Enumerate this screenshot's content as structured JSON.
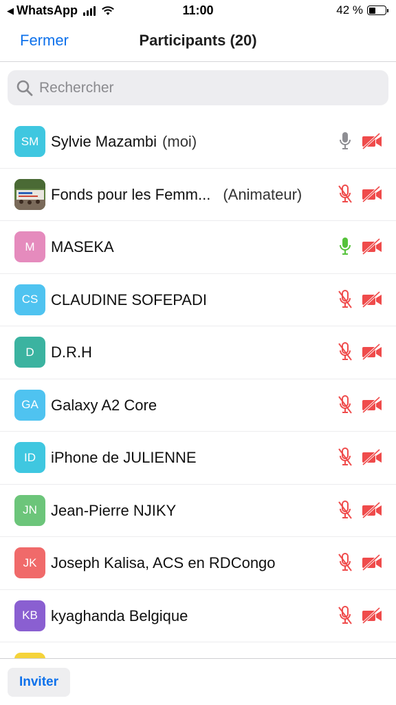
{
  "status_bar": {
    "back_app": "WhatsApp",
    "time": "11:00",
    "battery": "42 %",
    "battery_level": 0.42
  },
  "nav": {
    "close_label": "Fermer",
    "title": "Participants (20)"
  },
  "search": {
    "placeholder": "Rechercher"
  },
  "participants": [
    {
      "initials": "SM",
      "name": "Sylvie Mazambi",
      "suffix": "(moi)",
      "avatar_color": "#3fc7e0",
      "mic": "off-gray",
      "video": "off"
    },
    {
      "initials": "",
      "name": "Fonds pour les Femm...",
      "suffix": "(Animateur)",
      "avatar_color": "#6b8e4e",
      "mic": "muted",
      "video": "off"
    },
    {
      "initials": "M",
      "name": "MASEKA",
      "suffix": "",
      "avatar_color": "#e58bbd",
      "mic": "active",
      "video": "off"
    },
    {
      "initials": "CS",
      "name": "CLAUDINE SOFEPADI",
      "suffix": "",
      "avatar_color": "#4fc3f0",
      "mic": "muted",
      "video": "off"
    },
    {
      "initials": "D",
      "name": "D.R.H",
      "suffix": "",
      "avatar_color": "#3bb3a0",
      "mic": "muted",
      "video": "off"
    },
    {
      "initials": "GA",
      "name": "Galaxy A2 Core",
      "suffix": "",
      "avatar_color": "#4fc3f0",
      "mic": "muted",
      "video": "off"
    },
    {
      "initials": "ID",
      "name": "iPhone de JULIENNE",
      "suffix": "",
      "avatar_color": "#3fc7e0",
      "mic": "muted",
      "video": "off"
    },
    {
      "initials": "JN",
      "name": "Jean-Pierre NJIKY",
      "suffix": "",
      "avatar_color": "#6cc57a",
      "mic": "muted",
      "video": "off"
    },
    {
      "initials": "JK",
      "name": "Joseph Kalisa, ACS en RDCongo",
      "suffix": "",
      "avatar_color": "#f06a6a",
      "mic": "muted",
      "video": "off"
    },
    {
      "initials": "KB",
      "name": "kyaghanda Belgique",
      "suffix": "",
      "avatar_color": "#8a5fd1",
      "mic": "muted",
      "video": "off"
    },
    {
      "initials": "",
      "name": "",
      "suffix": "",
      "avatar_color": "#f5d33a",
      "mic": "none",
      "video": "none"
    }
  ],
  "bottom": {
    "invite_label": "Inviter"
  },
  "colors": {
    "accent": "#0e71eb",
    "muted_red": "#ef4b4b",
    "active_green": "#55c23a",
    "gray_icon": "#8e8e93"
  }
}
